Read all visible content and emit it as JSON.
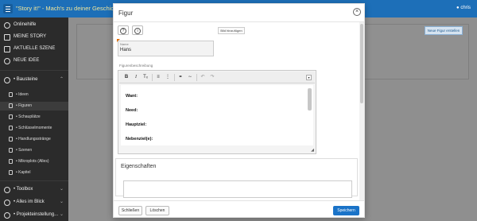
{
  "topbar": {
    "app_title": "\"Story it!\" - Mach's zu deiner Geschichte.",
    "user_name": "chris"
  },
  "sidebar": {
    "items": [
      {
        "label": "Onlinehilfe",
        "icon": "question-icon"
      },
      {
        "label": "MEINE STORY",
        "icon": "book-icon"
      },
      {
        "label": "AKTUELLE SZENE",
        "icon": "film-icon"
      },
      {
        "label": "NEUE IDEE",
        "icon": "lightbulb-icon"
      },
      {
        "label": "• Bausteine",
        "icon": "blocks-icon"
      },
      {
        "label": "• Toolbox",
        "icon": "tools-icon"
      },
      {
        "label": "• Alles im Blick",
        "icon": "grid-icon"
      },
      {
        "label": "• Projekteinstellung...",
        "icon": "settings-icon"
      }
    ],
    "subitems": [
      {
        "label": "• Ideen",
        "icon": "idea-icon"
      },
      {
        "label": "• Figuren",
        "icon": "person-icon"
      },
      {
        "label": "• Schauplätze",
        "icon": "location-icon"
      },
      {
        "label": "• Schlüsselmomente",
        "icon": "heart-icon"
      },
      {
        "label": "• Handlungsstränge",
        "icon": "list-icon"
      },
      {
        "label": "• Szenen",
        "icon": "scene-icon"
      },
      {
        "label": "• Mikroplots (Alles)",
        "icon": "plot-icon"
      },
      {
        "label": "• Kapitel",
        "icon": "chapter-icon"
      }
    ]
  },
  "background": {
    "new_figure_button": "Neue Figur erstellen"
  },
  "modal": {
    "title": "Figur",
    "import_button": "Bild hinzufügen",
    "name_label": "Name",
    "name_value": "Hans",
    "description_label": "Figurenbeschreibung",
    "editor_lines": [
      "Want:",
      "Need:",
      "Hauptziel:",
      "Nebenziel(e):"
    ],
    "properties_title": "Eigenschaften",
    "footer": {
      "delete_label": "Schließen",
      "clear_label": "Löschen",
      "save_label": "Speichern"
    }
  }
}
